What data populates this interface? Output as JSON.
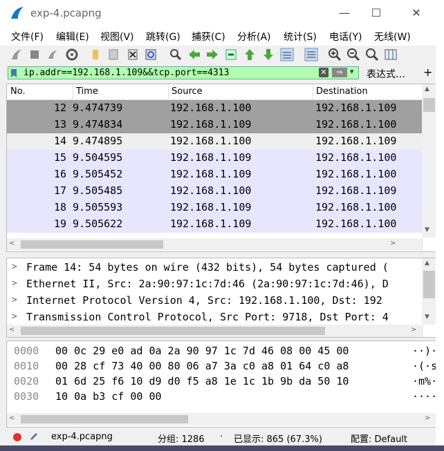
{
  "window": {
    "title": "exp-4.pcapng",
    "min": "—",
    "max": "☐",
    "close": "✕"
  },
  "menu": [
    "文件(F)",
    "编辑(E)",
    "视图(V)",
    "跳转(G)",
    "捕获(C)",
    "分析(A)",
    "统计(S)",
    "电话(Y)",
    "无线(W)"
  ],
  "filter": {
    "value": "ip.addr==192.168.1.109&&tcp.port==4313",
    "expression": "表达式…",
    "plus": "+"
  },
  "columns": [
    "No.",
    "Time",
    "Source",
    "Destination"
  ],
  "packets": [
    {
      "no": "12",
      "time": "9.474739",
      "src": "192.168.1.100",
      "dst": "192.168.1.109"
    },
    {
      "no": "13",
      "time": "9.474834",
      "src": "192.168.1.109",
      "dst": "192.168.1.100"
    },
    {
      "no": "14",
      "time": "9.474895",
      "src": "192.168.1.100",
      "dst": "192.168.1.109"
    },
    {
      "no": "15",
      "time": "9.504595",
      "src": "192.168.1.109",
      "dst": "192.168.1.100"
    },
    {
      "no": "16",
      "time": "9.505452",
      "src": "192.168.1.109",
      "dst": "192.168.1.100"
    },
    {
      "no": "17",
      "time": "9.505485",
      "src": "192.168.1.100",
      "dst": "192.168.1.109"
    },
    {
      "no": "18",
      "time": "9.505593",
      "src": "192.168.1.109",
      "dst": "192.168.1.100"
    },
    {
      "no": "19",
      "time": "9.505622",
      "src": "192.168.1.109",
      "dst": "192.168.1.100"
    }
  ],
  "details": [
    "Frame 14: 54 bytes on wire (432 bits), 54 bytes captured (",
    "Ethernet II, Src: 2a:90:97:1c:7d:46 (2a:90:97:1c:7d:46), D",
    "Internet Protocol Version 4, Src: 192.168.1.100, Dst: 192",
    "Transmission Control Protocol, Src Port: 9718, Dst Port: 4"
  ],
  "hex": [
    {
      "offset": "0000",
      "bytes": "00 0c 29 e0 ad 0a 2a 90  97 1c 7d 46 08 00 45 00",
      "ascii": "··)·"
    },
    {
      "offset": "0010",
      "bytes": "00 28 cf 73 40 00 80 06  a7 3a c0 a8 01 64 c0 a8",
      "ascii": "·(·s@"
    },
    {
      "offset": "0020",
      "bytes": "01 6d 25 f6 10 d9 d0 f5  a8 1e 1c 1b 9b da 50 10",
      "ascii": "·m%·"
    },
    {
      "offset": "0030",
      "bytes": "10 0a b3 cf 00 00",
      "ascii": "····"
    }
  ],
  "status": {
    "file": "exp-4.pcapng",
    "packets": "分组: 1286",
    "displayed": "已显示: 865 (67.3%)",
    "profile": "配置: Default"
  },
  "colors": {
    "selected": "#a0a0a0",
    "row_light": "#e7e6ff",
    "filter_ok": "#afffaf"
  }
}
